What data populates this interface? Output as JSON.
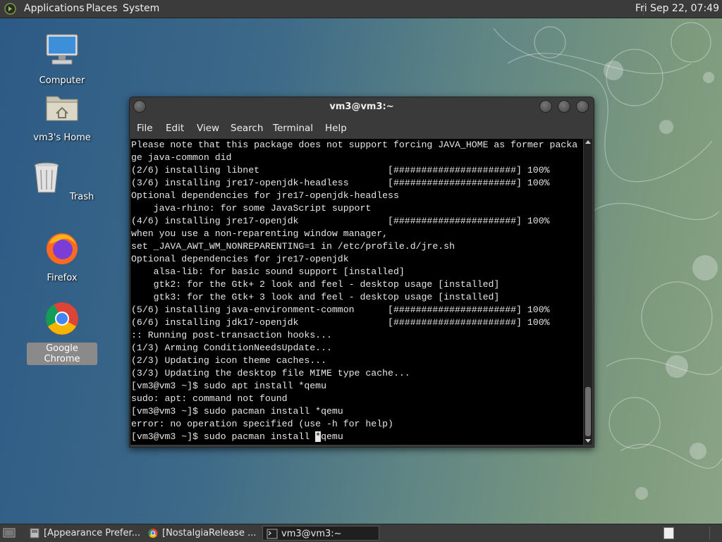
{
  "top_panel": {
    "menus": [
      "Applications",
      "Places",
      "System"
    ],
    "clock": "Fri Sep 22, 07:49"
  },
  "desktop_icons": [
    {
      "label": "Computer",
      "icon": "computer-icon"
    },
    {
      "label": "vm3's Home",
      "icon": "home-folder-icon"
    },
    {
      "label": "Trash",
      "icon": "trash-icon"
    },
    {
      "label": "Firefox",
      "icon": "firefox-icon"
    },
    {
      "label": "Google Chrome",
      "icon": "chrome-icon",
      "selected": true
    }
  ],
  "terminal": {
    "title": "vm3@vm3:~",
    "menu": [
      "File",
      "Edit",
      "View",
      "Search",
      "Terminal",
      "Help"
    ],
    "lines": [
      "Please note that this package does not support forcing JAVA_HOME as former packa",
      "ge java-common did",
      "(2/6) installing libnet                       [######################] 100%",
      "(3/6) installing jre17-openjdk-headless       [######################] 100%",
      "Optional dependencies for jre17-openjdk-headless",
      "    java-rhino: for some JavaScript support",
      "(4/6) installing jre17-openjdk                [######################] 100%",
      "when you use a non-reparenting window manager,",
      "set _JAVA_AWT_WM_NONREPARENTING=1 in /etc/profile.d/jre.sh",
      "Optional dependencies for jre17-openjdk",
      "    alsa-lib: for basic sound support [installed]",
      "    gtk2: for the Gtk+ 2 look and feel - desktop usage [installed]",
      "    gtk3: for the Gtk+ 3 look and feel - desktop usage [installed]",
      "(5/6) installing java-environment-common      [######################] 100%",
      "(6/6) installing jdk17-openjdk                [######################] 100%",
      ":: Running post-transaction hooks...",
      "(1/3) Arming ConditionNeedsUpdate...",
      "(2/3) Updating icon theme caches...",
      "(3/3) Updating the desktop file MIME type cache...",
      "[vm3@vm3 ~]$ sudo apt install *qemu",
      "sudo: apt: command not found",
      "[vm3@vm3 ~]$ sudo pacman install *qemu",
      "error: no operation specified (use -h for help)"
    ],
    "prompt_line": {
      "before_cursor": "[vm3@vm3 ~]$ sudo pacman install ",
      "cursor_char": "*",
      "after_cursor": "qemu"
    }
  },
  "taskbar": {
    "tasks": [
      {
        "label": "[Appearance Prefer...",
        "icon": "appearance-icon",
        "active": false
      },
      {
        "label": "[NostalgiaRelease ...",
        "icon": "chrome-icon",
        "active": false
      },
      {
        "label": "vm3@vm3:~",
        "icon": "terminal-icon",
        "active": true
      }
    ]
  },
  "colors": {
    "panel": "#3b3b3b",
    "terminal_bg": "#000000",
    "terminal_fg": "#e6e6e6"
  }
}
